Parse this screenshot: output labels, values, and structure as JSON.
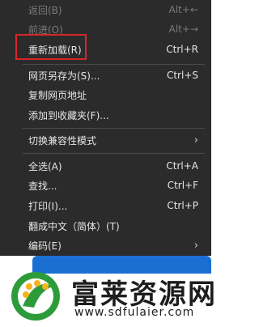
{
  "menu": {
    "items": [
      {
        "label": "返回(B)",
        "accel": "Alt+←"
      },
      {
        "label": "前进(O)",
        "accel": "Alt+→"
      },
      {
        "label": "重新加载(R)",
        "accel": "Ctrl+R"
      },
      {
        "label": "网页另存为(S)...",
        "accel": "Ctrl+S"
      },
      {
        "label": "复制网页地址",
        "accel": ""
      },
      {
        "label": "添加到收藏夹(F)...",
        "accel": ""
      },
      {
        "label": "切换兼容性模式",
        "accel": ""
      },
      {
        "label": "全选(A)",
        "accel": "Ctrl+A"
      },
      {
        "label": "查找...",
        "accel": "Ctrl+F"
      },
      {
        "label": "打印(I)...",
        "accel": "Ctrl+P"
      },
      {
        "label": "翻成中文（简体）(T)",
        "accel": ""
      },
      {
        "label": "编码(E)",
        "accel": ""
      }
    ],
    "submenu_arrow": "›"
  },
  "banner": {
    "title": "富莱资源网",
    "site": "www.sdfulaier.com"
  },
  "colors": {
    "menu_bg": "#2b2b2b",
    "highlight_border": "#d9262b",
    "brand_blue": "#1b6fd3",
    "brand_green": "#2e9b3a",
    "brand_yellow": "#f2b51c"
  }
}
